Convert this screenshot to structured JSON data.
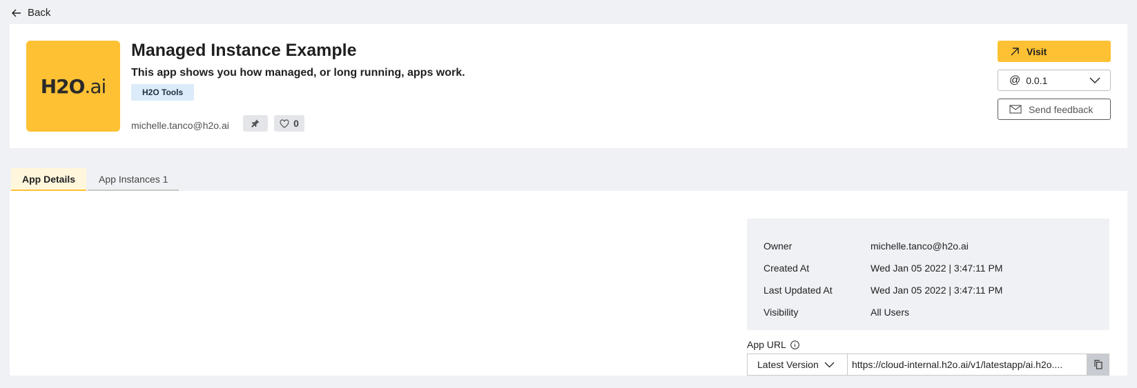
{
  "nav": {
    "back_label": "Back"
  },
  "app": {
    "logo_main": "H2O",
    "logo_sub": ".ai",
    "title": "Managed Instance Example",
    "description": "This app shows you how managed, or long running, apps work.",
    "tag": "H2O Tools",
    "author": "michelle.tanco@h2o.ai",
    "likes": "0"
  },
  "actions": {
    "visit_label": "Visit",
    "version_prefix": "@",
    "version_value": "0.0.1",
    "feedback_label": "Send feedback"
  },
  "tabs": [
    {
      "label": "App Details",
      "active": true
    },
    {
      "label": "App Instances 1",
      "active": false
    }
  ],
  "details": {
    "rows": [
      {
        "key": "Owner",
        "value": "michelle.tanco@h2o.ai"
      },
      {
        "key": "Created At",
        "value": "Wed Jan 05 2022 | 3:47:11 PM"
      },
      {
        "key": "Last Updated At",
        "value": "Wed Jan 05 2022 | 3:47:11 PM"
      },
      {
        "key": "Visibility",
        "value": "All Users"
      }
    ]
  },
  "app_url": {
    "label": "App URL",
    "version_option": "Latest Version",
    "url": "https://cloud-internal.h2o.ai/v1/latestapp/ai.h2o...."
  },
  "colors": {
    "accent": "#fec133",
    "background": "#f0f1f5",
    "tag_bg": "#dcebfa"
  }
}
